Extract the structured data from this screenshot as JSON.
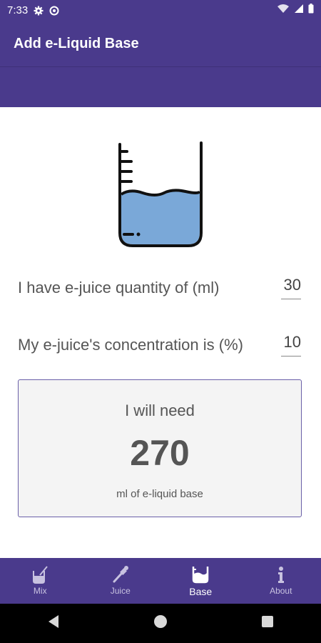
{
  "status_bar": {
    "time": "7:33"
  },
  "app_bar": {
    "title": "Add e-Liquid Base"
  },
  "form": {
    "quantity_label": "I have e-juice quantity of (ml)",
    "quantity_value": "30",
    "concentration_label": "My e-juice's concentration is (%)",
    "concentration_value": "10"
  },
  "result": {
    "intro": "I will need",
    "amount": "270",
    "unit": "ml of e-liquid base"
  },
  "bottom_nav": {
    "items": [
      {
        "label": "Mix",
        "icon": "mix-icon"
      },
      {
        "label": "Juice",
        "icon": "dropper-icon"
      },
      {
        "label": "Base",
        "icon": "beaker-icon",
        "active": true
      },
      {
        "label": "About",
        "icon": "info-icon"
      }
    ]
  },
  "colors": {
    "primary": "#4a3a8c",
    "liquid": "#7aa8d8"
  }
}
